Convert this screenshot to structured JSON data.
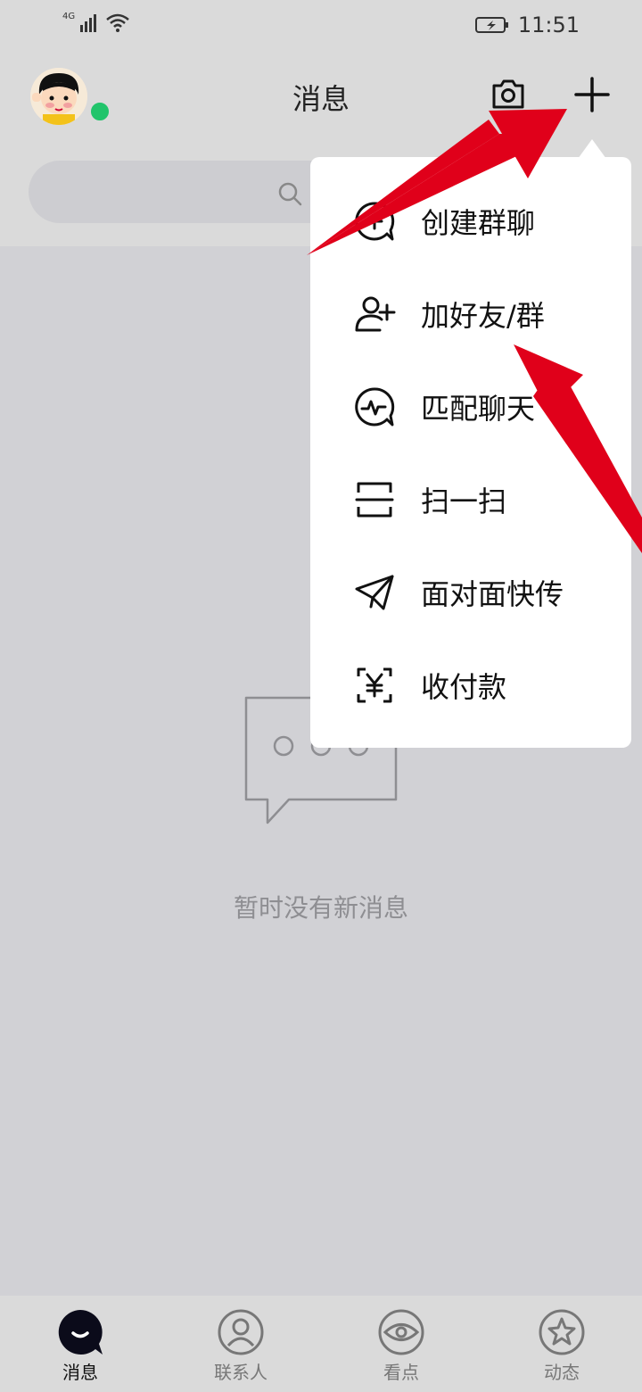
{
  "status_bar": {
    "network": "4G",
    "time": "11:51"
  },
  "header": {
    "title": "消息"
  },
  "search": {
    "placeholder": ""
  },
  "menu": {
    "items": [
      {
        "label": "创建群聊",
        "icon": "create-group-chat-icon"
      },
      {
        "label": "加好友/群",
        "icon": "add-friend-icon"
      },
      {
        "label": "匹配聊天",
        "icon": "match-chat-icon"
      },
      {
        "label": "扫一扫",
        "icon": "scan-icon"
      },
      {
        "label": "面对面快传",
        "icon": "paper-plane-icon"
      },
      {
        "label": "收付款",
        "icon": "payment-yuan-icon"
      }
    ]
  },
  "empty_state": {
    "message": "暂时没有新消息"
  },
  "bottom_nav": {
    "items": [
      {
        "label": "消息",
        "icon": "message-bubble-icon",
        "active": true
      },
      {
        "label": "联系人",
        "icon": "contacts-icon",
        "active": false
      },
      {
        "label": "看点",
        "icon": "eye-icon",
        "active": false
      },
      {
        "label": "动态",
        "icon": "star-icon",
        "active": false
      }
    ]
  },
  "colors": {
    "background": "#d1d1d5",
    "bar": "#dadada",
    "online": "#21c46b",
    "annotation_red": "#e0001a",
    "menu_bg": "#ffffff"
  }
}
